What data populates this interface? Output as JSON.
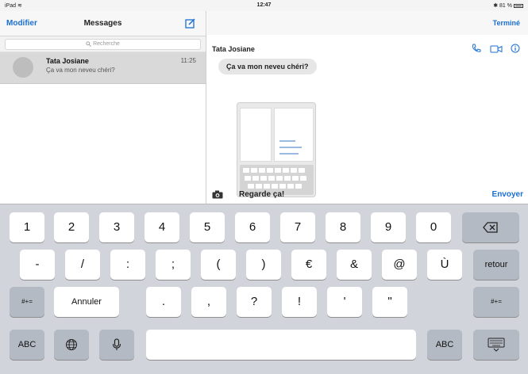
{
  "status_bar": {
    "left": "iPad",
    "time": "12:47",
    "battery": "81 %"
  },
  "conversation_list": {
    "edit_label": "Modifier",
    "title": "Messages",
    "search_placeholder": "Recherche",
    "conversations": [
      {
        "name": "Tata Josiane",
        "time": "11:25",
        "preview": "Ça va mon neveu chéri?"
      }
    ]
  },
  "thread": {
    "done_label": "Terminé",
    "contact_name": "Tata Josiane",
    "messages": [
      {
        "text": "Ça va mon neveu chéri?"
      }
    ],
    "draft_text": "Regarde ça!",
    "send_label": "Envoyer"
  },
  "keyboard": {
    "row1": [
      "1",
      "2",
      "3",
      "4",
      "5",
      "6",
      "7",
      "8",
      "9",
      "0"
    ],
    "row2": [
      "-",
      "/",
      ":",
      ";",
      "(",
      ")",
      "€",
      "&",
      "@",
      "Ù"
    ],
    "return_label": "retour",
    "row3_left": "#+=",
    "undo_label": "Annuler",
    "row3": [
      ".",
      ",",
      "?",
      "!",
      "'",
      "\""
    ],
    "row3_right": "#+=",
    "abc_left": "ABC",
    "abc_right": "ABC"
  },
  "colors": {
    "accent": "#1b6fd1",
    "keyboard_bg": "#d1d5db",
    "selected_row": "#d9d9d9"
  }
}
